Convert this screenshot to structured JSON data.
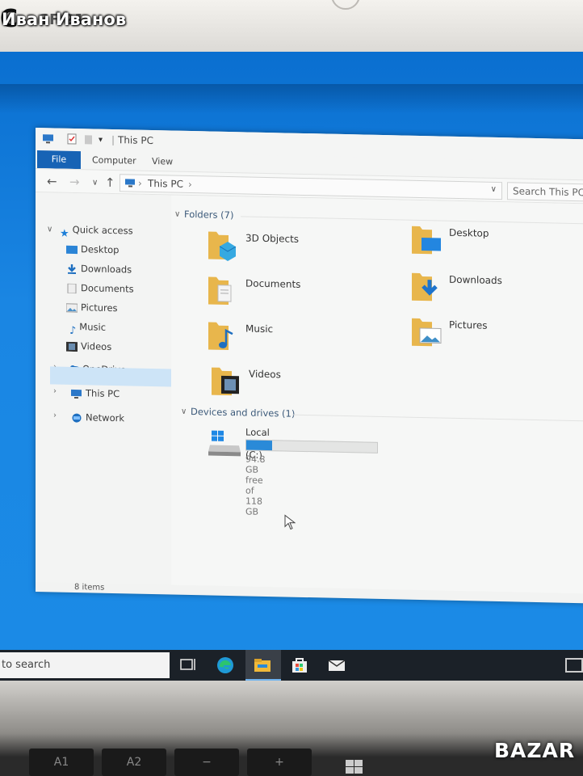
{
  "watermark": {
    "name": "Иван Иванов",
    "brand": "BAZAR"
  },
  "window": {
    "title": "This PC",
    "tabs": {
      "file": "File",
      "computer": "Computer",
      "view": "View"
    },
    "address": {
      "crumb": "This PC"
    },
    "search_placeholder": "Search This PC"
  },
  "navpane": {
    "quick_access": "Quick access",
    "items": [
      {
        "label": "Desktop",
        "icon": "desktop-icon",
        "pinned": true
      },
      {
        "label": "Downloads",
        "icon": "downloads-icon",
        "pinned": true
      },
      {
        "label": "Documents",
        "icon": "documents-icon",
        "pinned": true
      },
      {
        "label": "Pictures",
        "icon": "pictures-icon",
        "pinned": true
      },
      {
        "label": "Music",
        "icon": "music-icon",
        "pinned": false
      },
      {
        "label": "Videos",
        "icon": "videos-icon",
        "pinned": false
      }
    ],
    "onedrive": "OneDrive",
    "thispc": "This PC",
    "network": "Network"
  },
  "content": {
    "folders_header": "Folders (7)",
    "folders": [
      {
        "label": "3D Objects",
        "icon": "3d-objects-icon"
      },
      {
        "label": "Desktop",
        "icon": "desktop-folder-icon"
      },
      {
        "label": "Documents",
        "icon": "documents-folder-icon"
      },
      {
        "label": "Downloads",
        "icon": "downloads-folder-icon"
      },
      {
        "label": "Music",
        "icon": "music-folder-icon"
      },
      {
        "label": "Pictures",
        "icon": "pictures-folder-icon"
      },
      {
        "label": "Videos",
        "icon": "videos-folder-icon"
      }
    ],
    "devices_header": "Devices and drives (1)",
    "drive": {
      "label": "Local Disk (C:)",
      "free_text": "94.8 GB free of 118 GB",
      "used_fraction": 0.197
    }
  },
  "status": {
    "items": "8 items"
  },
  "taskbar": {
    "search_text": "to search"
  },
  "keys": [
    "A1",
    "A2",
    "−",
    "+"
  ],
  "colors": {
    "desktop": "#1b8be6",
    "accent": "#1763b5",
    "selection": "#cde4f7",
    "folder": "#e8b64c"
  }
}
